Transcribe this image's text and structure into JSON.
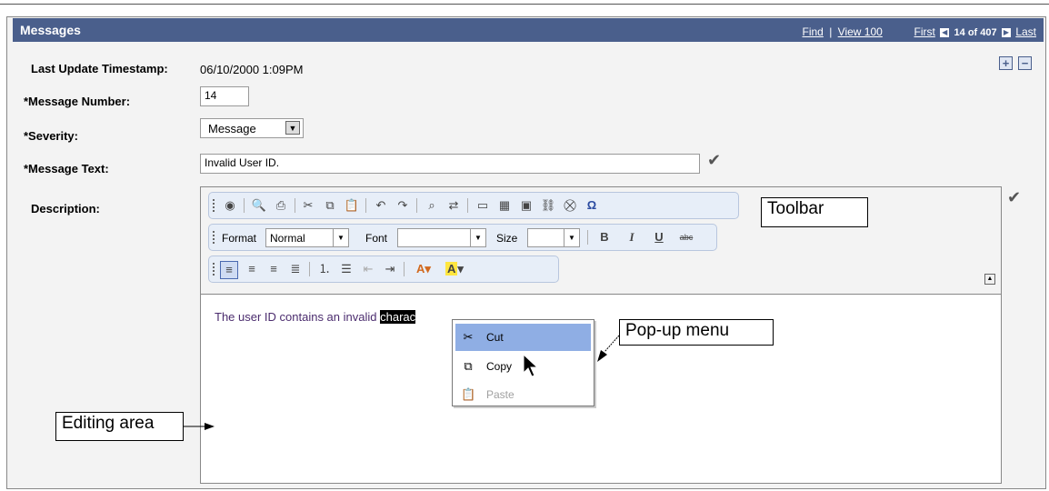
{
  "header": {
    "title": "Messages",
    "find": "Find",
    "view": "View 100",
    "first": "First",
    "count": "14 of 407",
    "last": "Last"
  },
  "controls": {
    "add": "+",
    "remove": "−"
  },
  "form": {
    "timestamp_label": "Last Update Timestamp:",
    "timestamp_value": "06/10/2000  1:09PM",
    "msgnum_label": "*Message Number:",
    "msgnum_value": "14",
    "severity_label": "*Severity:",
    "severity_value": "Message",
    "msgtext_label": "*Message Text:",
    "msgtext_value": "Invalid User ID.",
    "description_label": "Description:"
  },
  "toolbar": {
    "format_label": "Format",
    "format_value": "Normal",
    "font_label": "Font",
    "font_value": "",
    "size_label": "Size",
    "size_value": "",
    "bold": "B",
    "italic": "I",
    "underline": "U",
    "strike": "abc"
  },
  "editor": {
    "text_before": "The user ID contains an invalid ",
    "text_selected": "charac"
  },
  "context_menu": {
    "items": [
      {
        "label": "Cut",
        "icon": "scissors-icon"
      },
      {
        "label": "Copy",
        "icon": "copy-icon"
      },
      {
        "label": "Paste",
        "icon": "paste-icon"
      }
    ]
  },
  "callouts": {
    "toolbar": "Toolbar",
    "popup": "Pop-up menu",
    "editing": "Editing area"
  }
}
